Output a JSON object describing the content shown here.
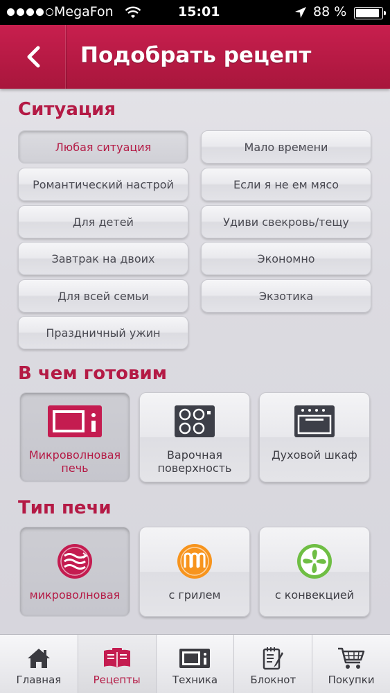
{
  "status_bar": {
    "carrier": "MegaFon",
    "time": "15:01",
    "battery": "88 %"
  },
  "header": {
    "title": "Подобрать рецепт"
  },
  "situation": {
    "title": "Ситуация",
    "options": [
      "Любая ситуация",
      "Мало времени",
      "Романтический настрой",
      "Если я не ем мясо",
      "Для детей",
      "Удиви свекровь/тещу",
      "Завтрак на двоих",
      "Экономно",
      "Для всей семьи",
      "Экзотика",
      "Праздничный ужин"
    ],
    "selected": "Любая ситуация"
  },
  "cooking": {
    "title": "В чем готовим",
    "items": [
      {
        "label": "Микроволновая печь",
        "icon": "microwave-icon"
      },
      {
        "label": "Варочная поверхность",
        "icon": "cooktop-icon"
      },
      {
        "label": "Духовой шкаф",
        "icon": "oven-icon"
      }
    ],
    "selected": "Микроволновая печь"
  },
  "oven_type": {
    "title": "Тип печи",
    "items": [
      {
        "label": "микроволновая",
        "icon": "microwave-waves-icon"
      },
      {
        "label": "с грилем",
        "icon": "grill-icon"
      },
      {
        "label": "с конвекцией",
        "icon": "fan-icon"
      }
    ],
    "selected": "микроволновая"
  },
  "tab_bar": {
    "tabs": [
      {
        "label": "Главная",
        "icon": "home-icon"
      },
      {
        "label": "Рецепты",
        "icon": "recipe-book-icon"
      },
      {
        "label": "Техника",
        "icon": "appliance-icon"
      },
      {
        "label": "Блокнот",
        "icon": "notepad-icon"
      },
      {
        "label": "Покупки",
        "icon": "cart-icon"
      }
    ],
    "active": "Рецепты"
  },
  "colors": {
    "accent": "#b41a45",
    "header": "#c81f4e",
    "grill": "#f7941d",
    "fan": "#6fbe44"
  }
}
